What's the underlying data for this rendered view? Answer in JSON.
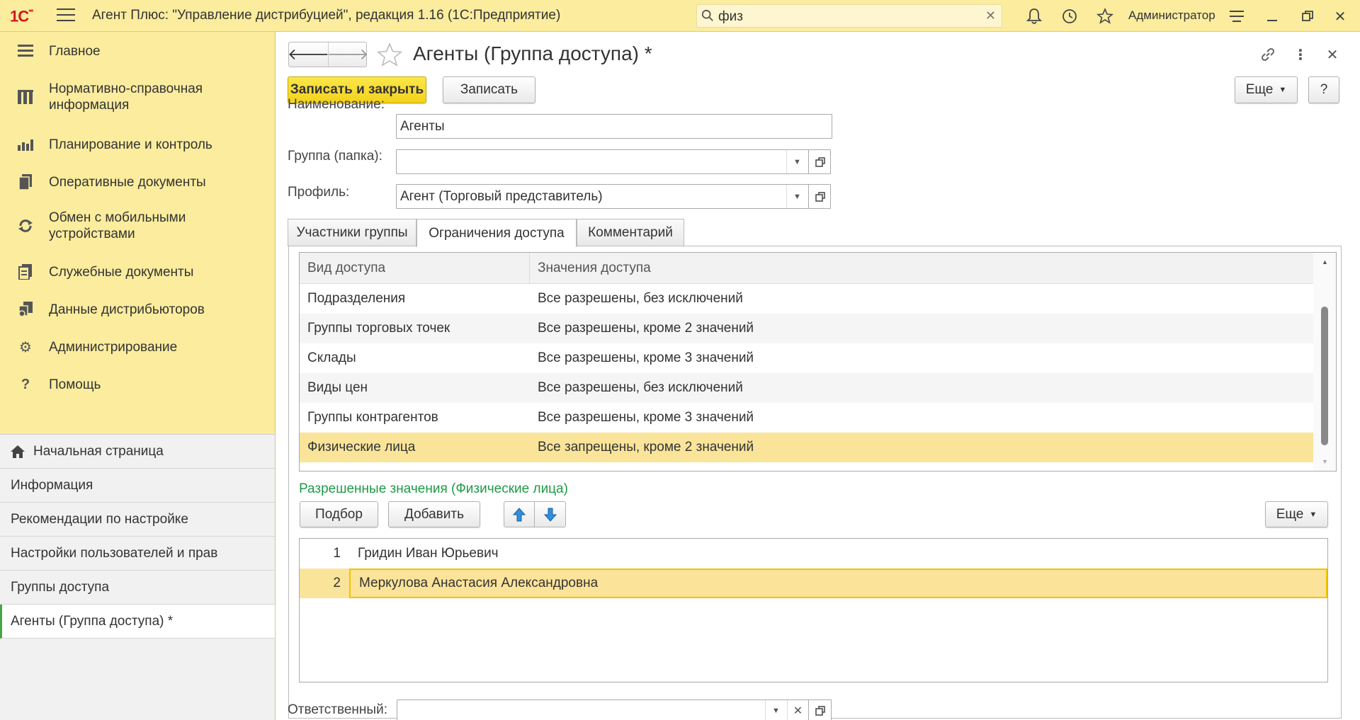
{
  "app": {
    "logo": "1С",
    "title": "Агент Плюс: \"Управление дистрибуцией\", редакция 1.16  (1С:Предприятие)",
    "search_value": "физ",
    "user": "Администратор"
  },
  "sidebar": {
    "sections": [
      {
        "label": "Главное",
        "icon": "menu-lines-icon"
      },
      {
        "label": "Нормативно-справочная информация",
        "icon": "catalog-icon"
      },
      {
        "label": "Планирование и контроль",
        "icon": "chart-icon"
      },
      {
        "label": "Оперативные документы",
        "icon": "documents-icon"
      },
      {
        "label": "Обмен с мобильными устройствами",
        "icon": "sync-icon"
      },
      {
        "label": "Служебные документы",
        "icon": "service-docs-icon"
      },
      {
        "label": "Данные дистрибьюторов",
        "icon": "distributors-icon"
      },
      {
        "label": "Администрирование",
        "icon": "gear-icon"
      },
      {
        "label": "Помощь",
        "icon": "help-icon"
      }
    ],
    "open_windows": [
      {
        "label": "Начальная страница"
      },
      {
        "label": "Информация"
      },
      {
        "label": "Рекомендации по настройке"
      },
      {
        "label": "Настройки пользователей и прав"
      },
      {
        "label": "Группы доступа"
      },
      {
        "label": "Агенты (Группа доступа) *"
      }
    ]
  },
  "form": {
    "title": "Агенты (Группа доступа) *",
    "save_close_label": "Записать и закрыть",
    "save_label": "Записать",
    "more_label": "Еще",
    "help_label": "?",
    "fields": {
      "name_label": "Наименование:",
      "name_value": "Агенты",
      "group_label": "Группа (папка):",
      "group_value": "",
      "profile_label": "Профиль:",
      "profile_value": "Агент (Торговый представитель)",
      "responsible_label": "Ответственный:",
      "responsible_value": ""
    },
    "tabs": [
      {
        "label": "Участники группы"
      },
      {
        "label": "Ограничения доступа"
      },
      {
        "label": "Комментарий"
      }
    ],
    "access_grid": {
      "columns": [
        "Вид доступа",
        "Значения доступа"
      ],
      "rows": [
        {
          "kind": "Подразделения",
          "value": "Все разрешены, без исключений"
        },
        {
          "kind": "Группы торговых точек",
          "value": "Все разрешены, кроме 2 значений"
        },
        {
          "kind": "Склады",
          "value": "Все разрешены, кроме 3 значений"
        },
        {
          "kind": "Виды цен",
          "value": "Все разрешены, без исключений"
        },
        {
          "kind": "Группы контрагентов",
          "value": "Все разрешены, кроме 3 значений"
        },
        {
          "kind": "Физические лица",
          "value": "Все запрещены, кроме 2 значений"
        }
      ]
    },
    "allowed": {
      "title": "Разрешенные значения (Физические лица)",
      "pick_label": "Подбор",
      "add_label": "Добавить",
      "more_label": "Еще",
      "rows": [
        {
          "num": "1",
          "name": "Гридин Иван Юрьевич"
        },
        {
          "num": "2",
          "name": "Меркулова Анастасия Александровна"
        }
      ]
    }
  },
  "colors": {
    "accent_yellow": "#fbec9e",
    "selected_row": "#f9e49a",
    "section_green": "#1f9a48",
    "logo_red": "#d2171c"
  }
}
